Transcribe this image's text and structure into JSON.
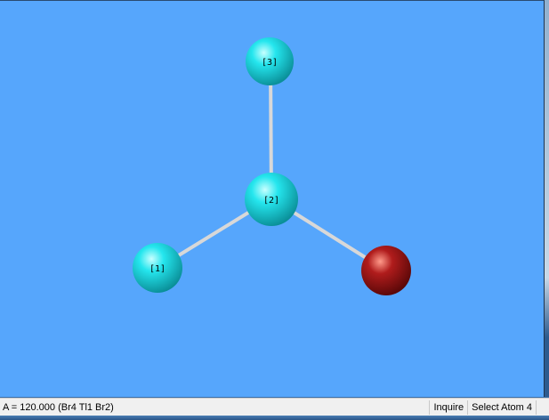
{
  "viewer": {
    "atoms": [
      {
        "label": "[3]",
        "element": "Br",
        "color": "#22e0e8"
      },
      {
        "label": "[2]",
        "element": "Tl",
        "color": "#22e0e8"
      },
      {
        "label": "[1]",
        "element": "Br",
        "color": "#22e0e8"
      },
      {
        "label": "",
        "element": "Br",
        "color": "#a01818"
      }
    ],
    "background": "#56a6fc"
  },
  "status": {
    "message": "A = 120.000 (Br4 Tl1 Br2)",
    "mode": "Inquire",
    "prompt": "Select Atom 4"
  }
}
